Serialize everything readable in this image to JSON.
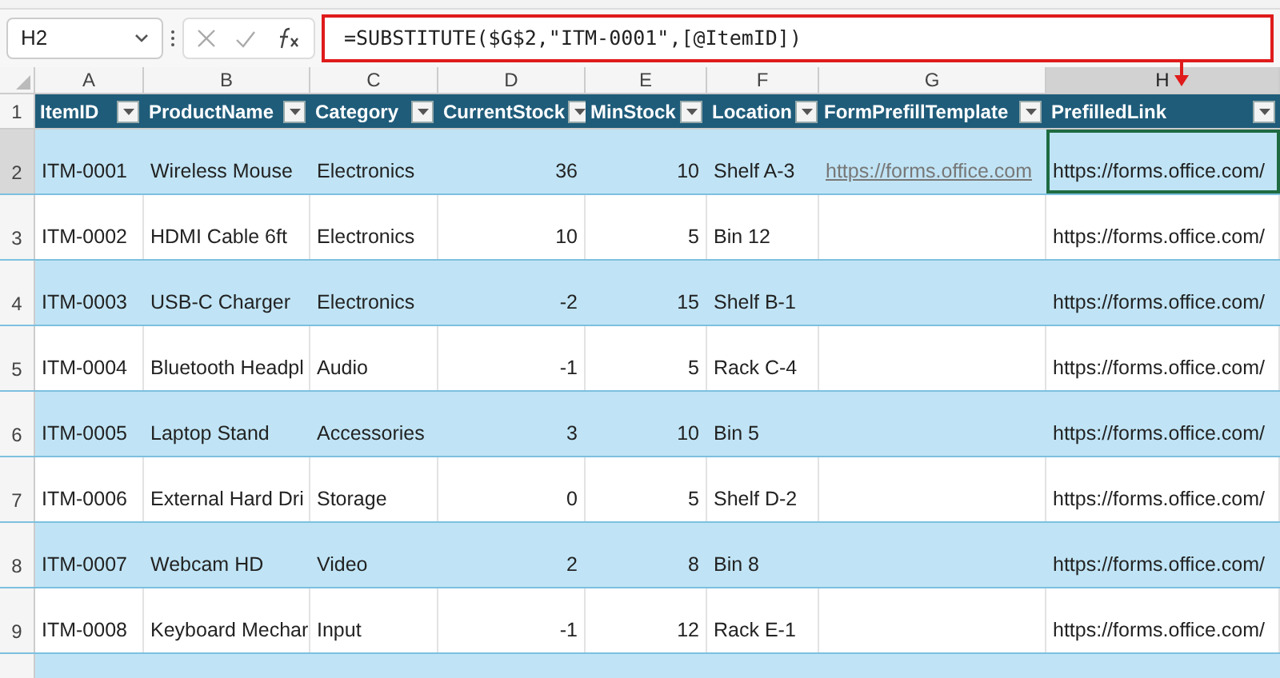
{
  "formula_bar": {
    "name_box": "H2",
    "formula": "=SUBSTITUTE($G$2,\"ITM-0001\",[@ItemID])",
    "highlighted": true
  },
  "table": {
    "columns": [
      {
        "letter": "A",
        "header": "ItemID",
        "kind": "text",
        "selected": false
      },
      {
        "letter": "B",
        "header": "ProductName",
        "kind": "text",
        "selected": false
      },
      {
        "letter": "C",
        "header": "Category",
        "kind": "text",
        "selected": false
      },
      {
        "letter": "D",
        "header": "CurrentStock",
        "kind": "number",
        "selected": false
      },
      {
        "letter": "E",
        "header": "MinStock",
        "kind": "number",
        "selected": false
      },
      {
        "letter": "F",
        "header": "Location",
        "kind": "text",
        "selected": false
      },
      {
        "letter": "G",
        "header": "FormPrefillTemplate",
        "kind": "link",
        "selected": false
      },
      {
        "letter": "H",
        "header": "PrefilledLink",
        "kind": "text",
        "selected": true
      }
    ],
    "header_row_number": "1",
    "rows": [
      {
        "number": "2",
        "selected": true,
        "cells": [
          "ITM-0001",
          "Wireless Mouse",
          "Electronics",
          "36",
          "10",
          "Shelf A-3",
          "https://forms.office.com",
          "https://forms.office.com/"
        ]
      },
      {
        "number": "3",
        "selected": false,
        "cells": [
          "ITM-0002",
          "HDMI Cable 6ft",
          "Electronics",
          "10",
          "5",
          "Bin 12",
          "",
          "https://forms.office.com/"
        ]
      },
      {
        "number": "4",
        "selected": false,
        "cells": [
          "ITM-0003",
          "USB-C Charger",
          "Electronics",
          "-2",
          "15",
          "Shelf B-1",
          "",
          "https://forms.office.com/"
        ]
      },
      {
        "number": "5",
        "selected": false,
        "cells": [
          "ITM-0004",
          "Bluetooth Headpl",
          "Audio",
          "-1",
          "5",
          "Rack C-4",
          "",
          "https://forms.office.com/"
        ]
      },
      {
        "number": "6",
        "selected": false,
        "cells": [
          "ITM-0005",
          "Laptop Stand",
          "Accessories",
          "3",
          "10",
          "Bin 5",
          "",
          "https://forms.office.com/"
        ]
      },
      {
        "number": "7",
        "selected": false,
        "cells": [
          "ITM-0006",
          "External Hard Dri",
          "Storage",
          "0",
          "5",
          "Shelf D-2",
          "",
          "https://forms.office.com/"
        ]
      },
      {
        "number": "8",
        "selected": false,
        "cells": [
          "ITM-0007",
          "Webcam HD",
          "Video",
          "2",
          "8",
          "Bin 8",
          "",
          "https://forms.office.com/"
        ]
      },
      {
        "number": "9",
        "selected": false,
        "cells": [
          "ITM-0008",
          "Keyboard Mechar",
          "Input",
          "-1",
          "12",
          "Rack E-1",
          "",
          "https://forms.office.com/"
        ]
      }
    ]
  }
}
